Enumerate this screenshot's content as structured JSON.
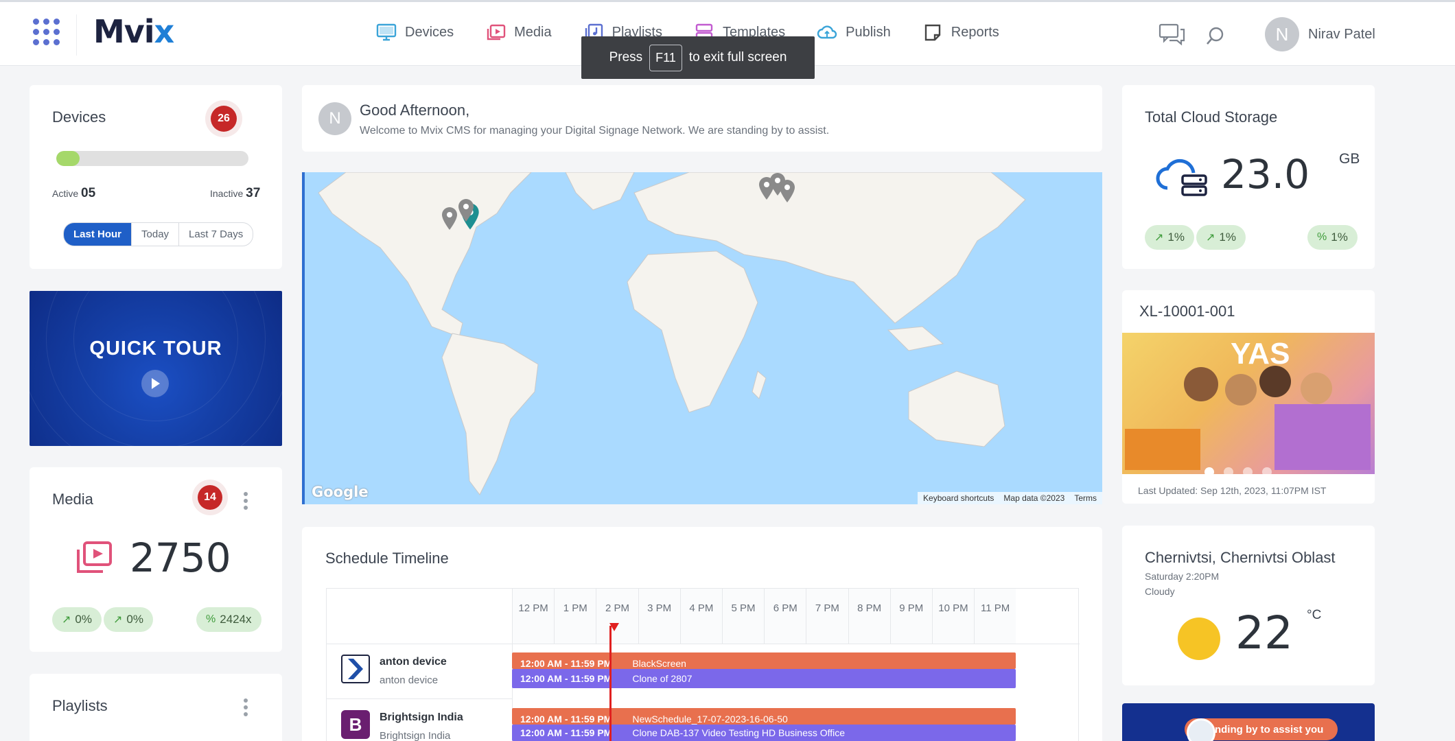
{
  "app": {
    "logo_main": "Mvi",
    "logo_accent": "x"
  },
  "nav": [
    {
      "label": "Devices",
      "icon": "monitor-icon",
      "color": "#3aa4d8"
    },
    {
      "label": "Media",
      "icon": "media-icon",
      "color": "#e0527a"
    },
    {
      "label": "Playlists",
      "icon": "playlist-icon",
      "color": "#5b6fd0"
    },
    {
      "label": "Templates",
      "icon": "templates-icon",
      "color": "#c25bd0"
    },
    {
      "label": "Publish",
      "icon": "cloud-icon",
      "color": "#3aa4d8"
    },
    {
      "label": "Reports",
      "icon": "reports-icon",
      "color": "#444444"
    }
  ],
  "fullscreen_toast": {
    "prefix": "Press",
    "key": "F11",
    "suffix": "to exit full screen"
  },
  "user": {
    "initial": "N",
    "name": "Nirav Patel"
  },
  "devices": {
    "title": "Devices",
    "count": "26",
    "active_label": "Active",
    "active_value": "05",
    "inactive_label": "Inactive",
    "inactive_value": "37",
    "active_fraction": 0.12,
    "ranges": [
      "Last Hour",
      "Today",
      "Last 7 Days"
    ],
    "selected_range": "Last Hour"
  },
  "quick_tour": {
    "title": "QUICK TOUR"
  },
  "media": {
    "title": "Media",
    "badge": "14",
    "total": "2750",
    "stats": [
      "0%",
      "0%",
      "2424x"
    ]
  },
  "playlists": {
    "title": "Playlists"
  },
  "greeting": {
    "initial": "N",
    "title": "Good Afternoon,",
    "subtitle": "Welcome to Mvix CMS for managing your Digital Signage Network. We are standing by to assist."
  },
  "map": {
    "logo": "Google",
    "attribution": [
      "Keyboard shortcuts",
      "Map data ©2023",
      "Terms"
    ]
  },
  "schedule": {
    "title": "Schedule Timeline",
    "hours": [
      "12 PM",
      "1 PM",
      "2 PM",
      "3 PM",
      "4 PM",
      "5 PM",
      "6 PM",
      "7 PM",
      "8 PM",
      "9 PM",
      "10 PM",
      "11 PM"
    ],
    "rows": [
      {
        "name": "anton device",
        "sub": "anton device",
        "bars": [
          {
            "time": "12:00 AM - 11:59 PM",
            "title": "BlackScreen"
          },
          {
            "time": "12:00 AM - 11:59 PM",
            "title": "Clone of 2807"
          }
        ]
      },
      {
        "name": "Brightsign India",
        "sub": "Brightsign India",
        "bars": [
          {
            "time": "12:00 AM - 11:59 PM",
            "title": "NewSchedule_17-07-2023-16-06-50"
          },
          {
            "time": "12:00 AM - 11:59 PM",
            "title": "Clone DAB-137 Video Testing HD Business Office"
          }
        ]
      }
    ]
  },
  "storage": {
    "title": "Total Cloud Storage",
    "value": "23.0",
    "unit": "GB",
    "stats": [
      "1%",
      "1%",
      "1%"
    ]
  },
  "device_preview": {
    "title": "XL-10001-001",
    "image_text": "YAS",
    "updated": "Last Updated: Sep 12th, 2023, 11:07PM IST"
  },
  "weather": {
    "location": "Chernivtsi, Chernivtsi Oblast",
    "time": "Saturday 2:20PM",
    "condition": "Cloudy",
    "temp": "22",
    "unit": "°C"
  },
  "assist": {
    "label": "Standing by to assist you"
  }
}
